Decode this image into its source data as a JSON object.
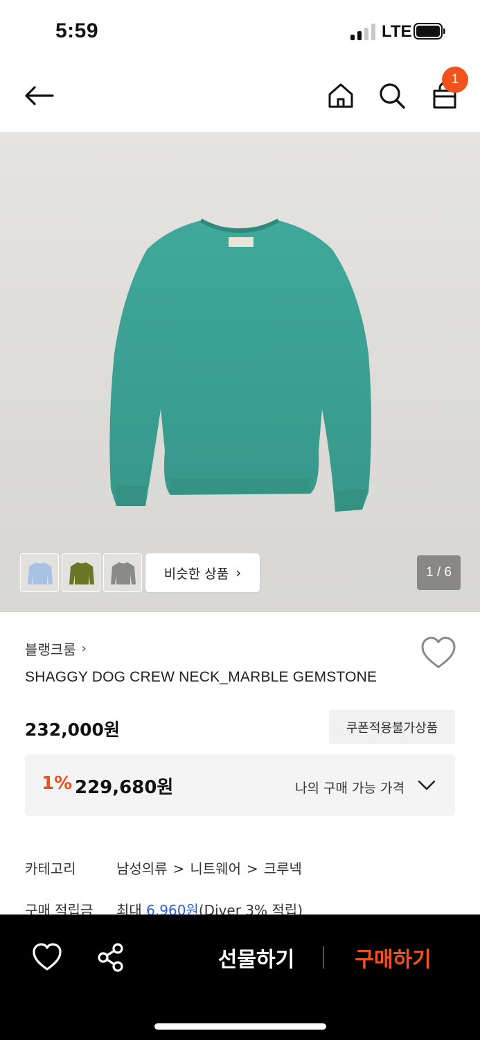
{
  "status_bar": {
    "time": "5:59",
    "network": "LTE"
  },
  "header": {
    "icons": [
      "back-arrow-icon",
      "home-icon",
      "search-icon",
      "shopping-bag-icon"
    ],
    "cart_badge": "1",
    "badge_color": "#f2531c"
  },
  "gallery": {
    "similar_label": "비슷한 상품",
    "chevron": "›",
    "counter": "1 / 6",
    "thumbnail_colors": [
      "#a9c2e4",
      "#6c7526",
      "#8a8a86"
    ]
  },
  "product": {
    "brand": "블랭크룸",
    "brand_chevron": "›",
    "title": "SHAGGY DOG CREW NECK_MARBLE GEMSTONE",
    "price": "232,000원",
    "coupon_notice": "쿠폰적용불가상품",
    "my_price": {
      "discount": "1%",
      "value": "229,680원",
      "label": "나의 구매 가능 가격"
    }
  },
  "details": {
    "category_label": "카테고리",
    "category_path": [
      "남성의류",
      "니트웨어",
      "크루넥"
    ],
    "category_sep": ">",
    "points_label": "구매 적립금",
    "points_prefix": "최대",
    "points_value": "6,960원",
    "points_suffix": "(Diver 3% 적립)"
  },
  "bottom_bar": {
    "gift_label": "선물하기",
    "buy_label": "구매하기",
    "accent_color": "#f2531c"
  }
}
